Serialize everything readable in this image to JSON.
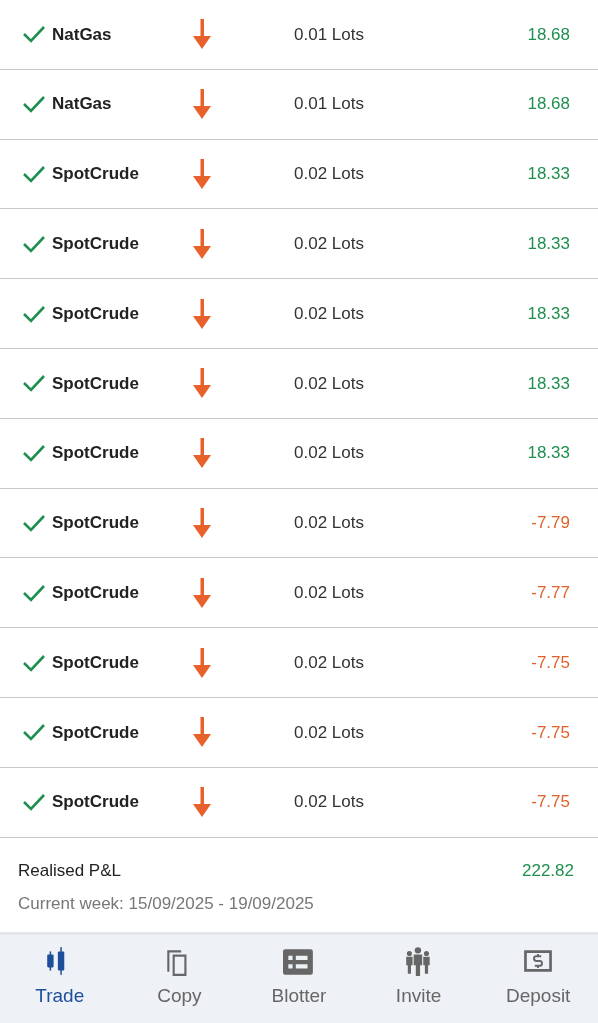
{
  "trades": [
    {
      "done": true,
      "symbol": "NatGas",
      "sell": true,
      "volume": "0.01 Lots",
      "pnl": "18.68",
      "color": "#1e8f4e"
    },
    {
      "done": true,
      "symbol": "NatGas",
      "sell": true,
      "volume": "0.01 Lots",
      "pnl": "18.68",
      "color": "#1e8f4e"
    },
    {
      "done": true,
      "symbol": "SpotCrude",
      "sell": true,
      "volume": "0.02 Lots",
      "pnl": "18.33",
      "color": "#1e8f4e"
    },
    {
      "done": true,
      "symbol": "SpotCrude",
      "sell": true,
      "volume": "0.02 Lots",
      "pnl": "18.33",
      "color": "#1e8f4e"
    },
    {
      "done": true,
      "symbol": "SpotCrude",
      "sell": true,
      "volume": "0.02 Lots",
      "pnl": "18.33",
      "color": "#1e8f4e"
    },
    {
      "done": true,
      "symbol": "SpotCrude",
      "sell": true,
      "volume": "0.02 Lots",
      "pnl": "18.33",
      "color": "#1e8f4e"
    },
    {
      "done": true,
      "symbol": "SpotCrude",
      "sell": true,
      "volume": "0.02 Lots",
      "pnl": "18.33",
      "color": "#1e8f4e"
    },
    {
      "done": true,
      "symbol": "SpotCrude",
      "sell": true,
      "volume": "0.02 Lots",
      "pnl": "-7.79",
      "color": "#e0622a"
    },
    {
      "done": true,
      "symbol": "SpotCrude",
      "sell": true,
      "volume": "0.02 Lots",
      "pnl": "-7.77",
      "color": "#e0622a"
    },
    {
      "done": true,
      "symbol": "SpotCrude",
      "sell": true,
      "volume": "0.02 Lots",
      "pnl": "-7.75",
      "color": "#e0622a"
    },
    {
      "done": true,
      "symbol": "SpotCrude",
      "sell": true,
      "volume": "0.02 Lots",
      "pnl": "-7.75",
      "color": "#e0622a"
    },
    {
      "done": true,
      "symbol": "SpotCrude",
      "sell": true,
      "volume": "0.02 Lots",
      "pnl": "-7.75",
      "color": "#e0622a"
    }
  ],
  "summary": {
    "label": "Realised P&L",
    "value": "222.82",
    "period": "Current week: 15/09/2025 - 19/09/2025"
  },
  "nav": [
    {
      "kind": "trade",
      "label": "Trade",
      "selected": true
    },
    {
      "kind": "copy",
      "label": "Copy",
      "selected": false
    },
    {
      "kind": "blotter",
      "label": "Blotter",
      "selected": false
    },
    {
      "kind": "invite",
      "label": "Invite",
      "selected": false
    },
    {
      "kind": "deposit",
      "label": "Deposit",
      "selected": false
    }
  ]
}
